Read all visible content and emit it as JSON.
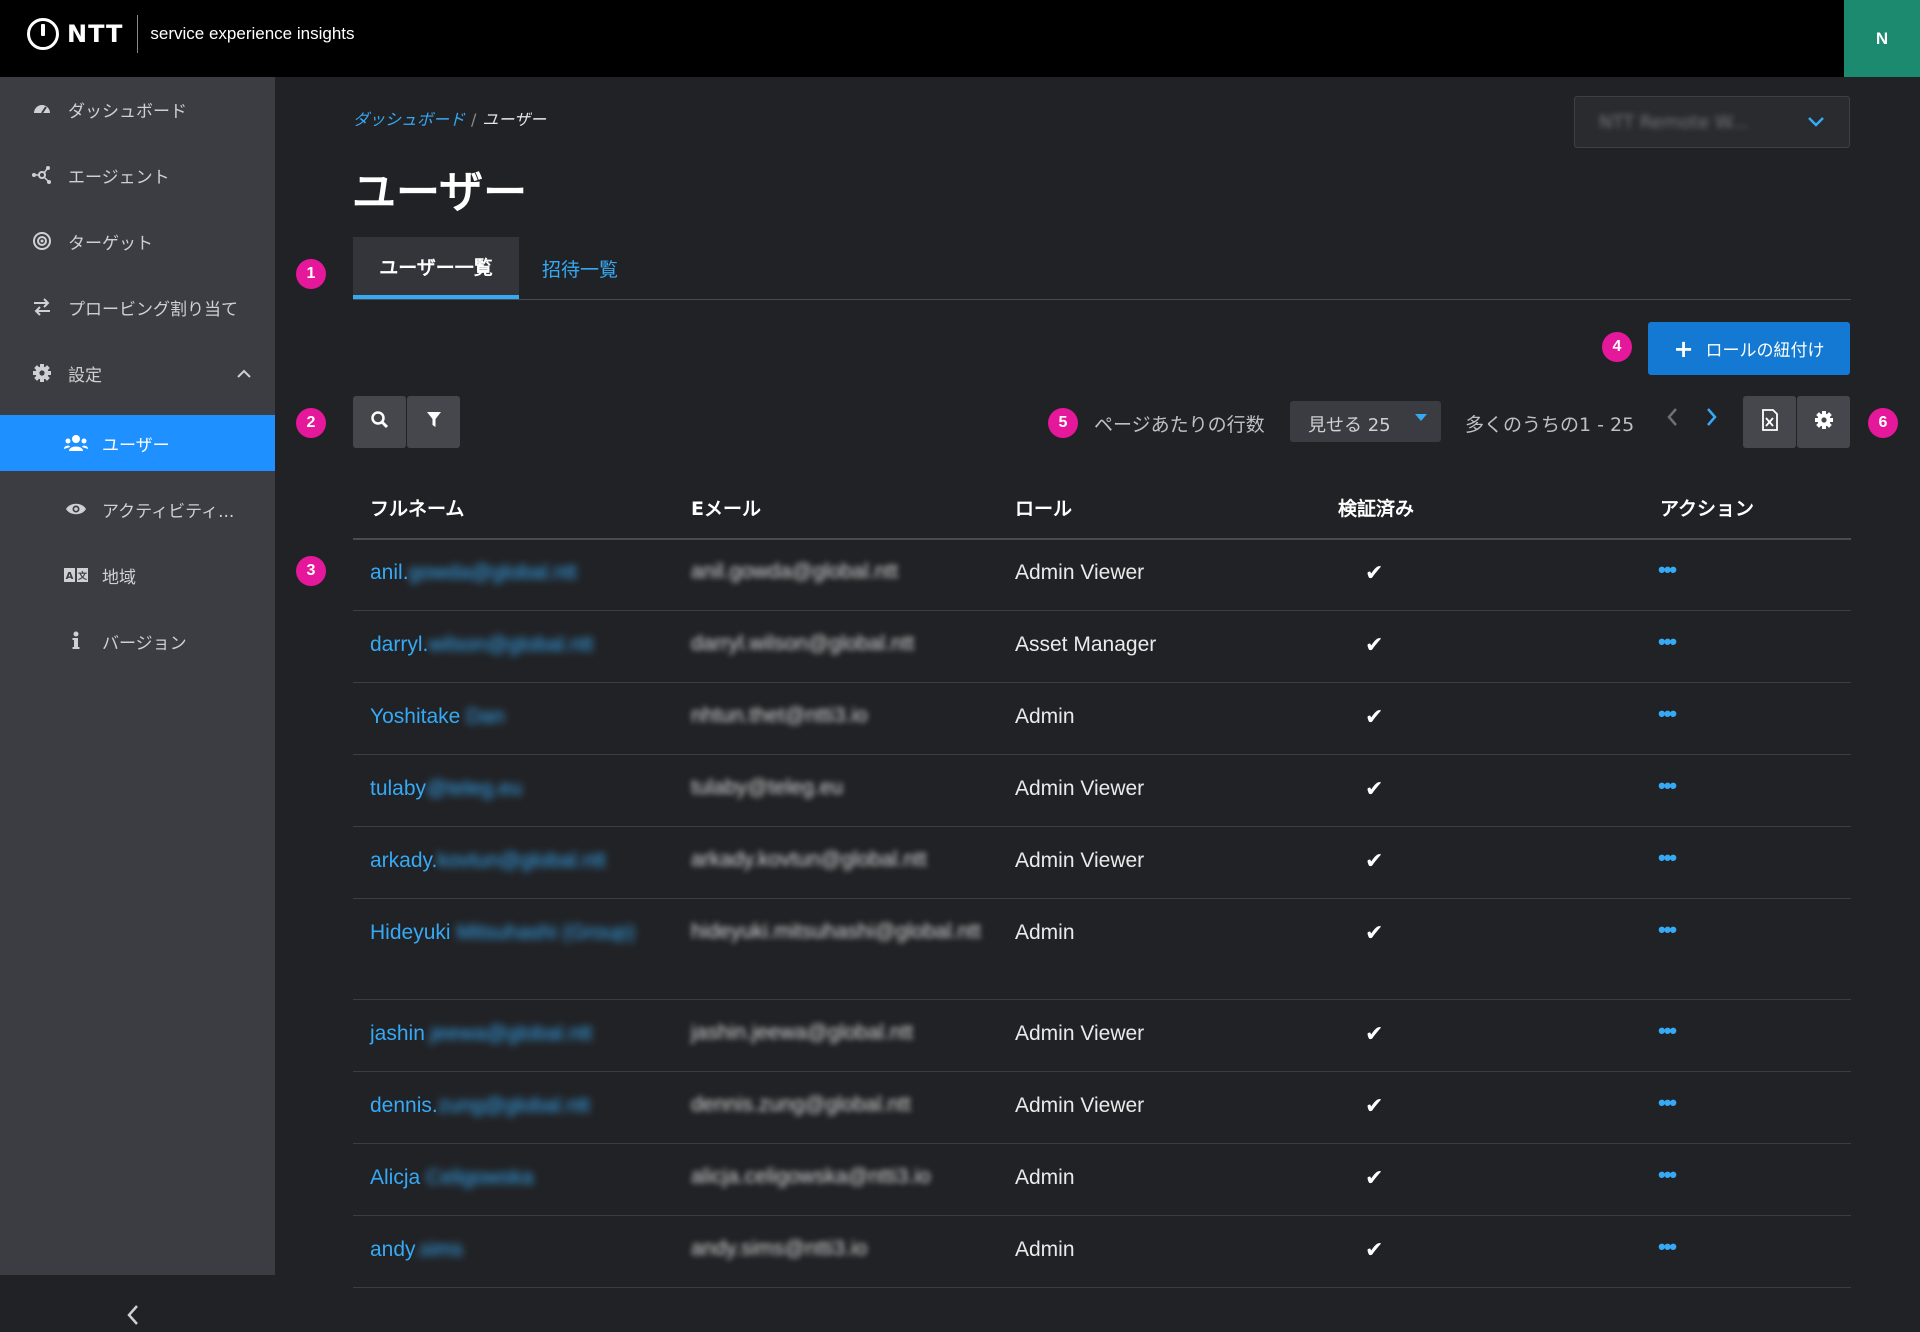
{
  "brand": {
    "logo_text": "NTT",
    "subtitle": "service experience insights",
    "avatar_initial": "N"
  },
  "sidebar": {
    "items": [
      {
        "label": "ダッシュボード",
        "icon": "dashboard-gauge-icon"
      },
      {
        "label": "エージェント",
        "icon": "agent-network-icon"
      },
      {
        "label": "ターゲット",
        "icon": "target-icon"
      },
      {
        "label": "プロービング割り当て",
        "icon": "swap-arrows-icon"
      },
      {
        "label": "設定",
        "icon": "gear-icon",
        "expanded": true
      },
      {
        "label": "ユーザー",
        "icon": "users-icon",
        "active": true
      },
      {
        "label": "アクティビティ...",
        "icon": "eye-icon"
      },
      {
        "label": "地域",
        "icon": "language-icon"
      },
      {
        "label": "バージョン",
        "icon": "info-icon"
      }
    ],
    "collapse_glyph": "<"
  },
  "breadcrumb": {
    "parent": "ダッシュボード",
    "separator": "/",
    "current": "ユーザー"
  },
  "page_title": "ユーザー",
  "org_selector": {
    "value": "NTT Remote W..."
  },
  "tabs": [
    {
      "label": "ユーザー一覧",
      "active": true
    },
    {
      "label": "招待一覧",
      "active": false
    }
  ],
  "toolbar": {
    "assign_role_label": "ロールの紐付け",
    "rows_per_page_label": "ページあたりの行数",
    "rows_select_value": "見せる 25",
    "range_text": "多くのうちの1 - 25"
  },
  "callouts": [
    "1",
    "2",
    "3",
    "4",
    "5",
    "6"
  ],
  "table": {
    "headers": [
      "フルネーム",
      "Eメール",
      "ロール",
      "検証済み",
      "アクション"
    ],
    "check_glyph": "✔",
    "action_glyph": "•••",
    "rows": [
      {
        "first": "anil.",
        "rest": "gowda@global.ntt",
        "email": "anil.gowda@global.ntt",
        "role": "Admin Viewer",
        "verified": true
      },
      {
        "first": "darryl.",
        "rest": "wilson@global.ntt",
        "email": "darryl.wilson@global.ntt",
        "role": "Asset Manager",
        "verified": true
      },
      {
        "first": "Yoshitake",
        "rest": " Dan",
        "email": "nhtun.thet@ntti3.io",
        "role": "Admin",
        "verified": true
      },
      {
        "first": "tulaby",
        "rest": "@teleg.eu",
        "email": "tulaby@teleg.eu",
        "role": "Admin Viewer",
        "verified": true
      },
      {
        "first": "arkady.",
        "rest": "kovtun@global.ntt",
        "email": "arkady.kovtun@global.ntt",
        "role": "Admin Viewer",
        "verified": true
      },
      {
        "first": "Hideyuki",
        "rest": " Mitsuhashi (Group)",
        "email": "hideyuki.mitsuhashi@global.ntt",
        "role": "Admin",
        "verified": true
      },
      {
        "first": "jashin",
        "rest": ".jeewa@global.ntt",
        "email": "jashin.jeewa@global.ntt",
        "role": "Admin Viewer",
        "verified": true
      },
      {
        "first": "dennis.",
        "rest": "zung@global.ntt",
        "email": "dennis.zung@global.ntt",
        "role": "Admin Viewer",
        "verified": true
      },
      {
        "first": "Alicja",
        "rest": " Celigowska",
        "email": "alicja.celigowska@ntti3.io",
        "role": "Admin",
        "verified": true
      },
      {
        "first": "andy",
        "rest": ".sims",
        "email": "andy.sims@ntti3.io",
        "role": "Admin",
        "verified": true
      }
    ]
  },
  "colors": {
    "accent": "#36a9f5",
    "primary_button": "#1479d2",
    "callout": "#e5179a",
    "avatar": "#1b8a6f",
    "sidebar_active": "#1e90ff"
  }
}
